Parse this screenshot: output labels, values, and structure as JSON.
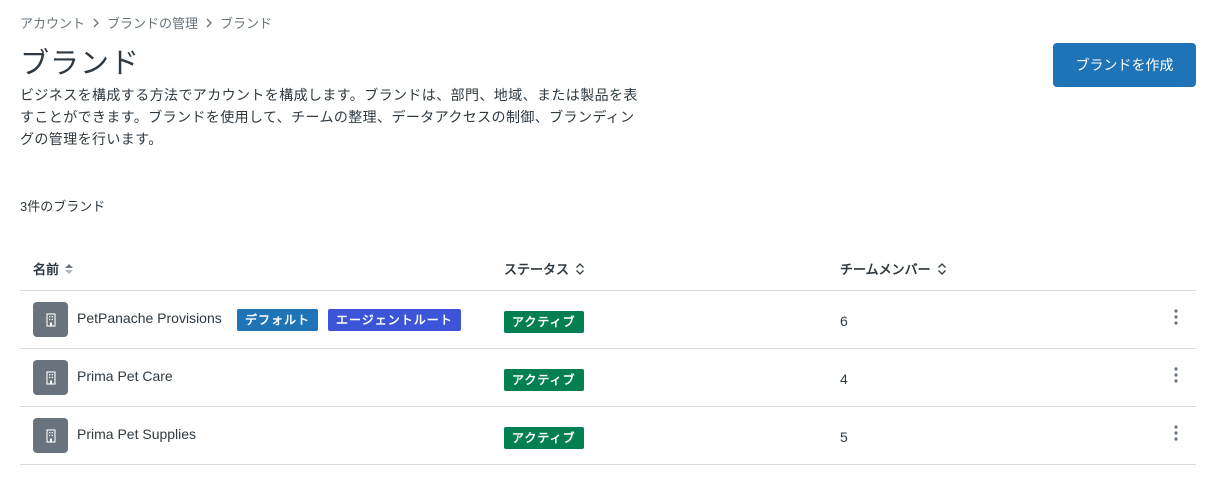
{
  "breadcrumb": {
    "items": [
      "アカウント",
      "ブランドの管理",
      "ブランド"
    ]
  },
  "page": {
    "title": "ブランド",
    "description": "ビジネスを構成する方法でアカウントを構成します。ブランドは、部門、地域、または製品を表すことができます。ブランドを使用して、チームの整理、データアクセスの制御、ブランディングの管理を行います。",
    "create_button": "ブランドを作成",
    "count_label": "3件のブランド"
  },
  "table": {
    "columns": {
      "name": "名前",
      "status": "ステータス",
      "members": "チームメンバー"
    },
    "rows": [
      {
        "name": "PetPanache Provisions",
        "badges": [
          "デフォルト",
          "エージェントルート"
        ],
        "status": "アクティブ",
        "members": "6"
      },
      {
        "name": "Prima Pet Care",
        "badges": [],
        "status": "アクティブ",
        "members": "4"
      },
      {
        "name": "Prima Pet Supplies",
        "badges": [],
        "status": "アクティブ",
        "members": "5"
      }
    ]
  },
  "colors": {
    "primary": "#1f73b7",
    "agent_badge": "#3c55d8",
    "active": "#037f52",
    "avatar": "#68737d"
  },
  "icons": {
    "breadcrumb_separator": "chevron-right-icon",
    "sort_active": "sort-icon",
    "sort": "sort-icon",
    "avatar": "building-icon",
    "row_menu": "more-vertical-icon"
  }
}
